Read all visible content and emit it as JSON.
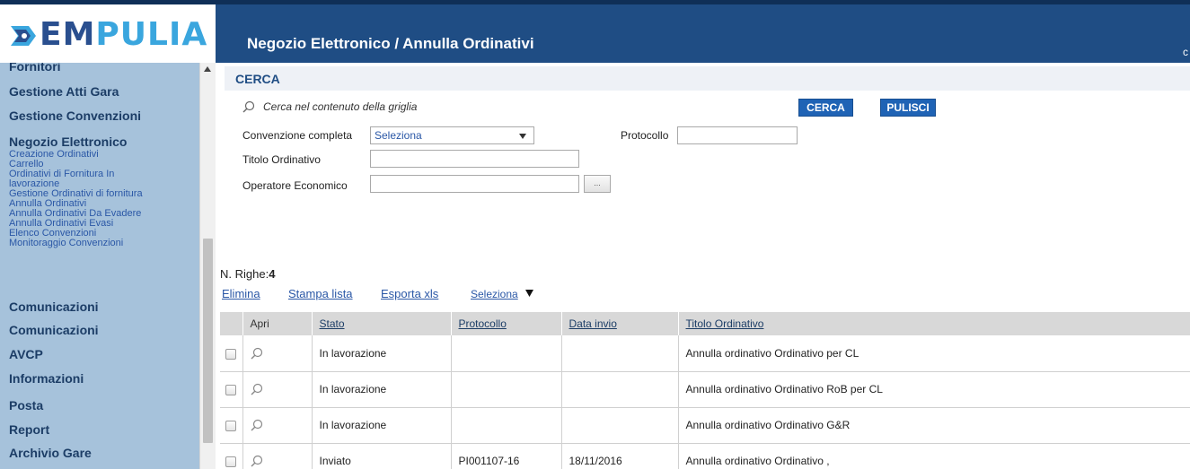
{
  "app": {
    "logo_part1": "EM",
    "logo_part2": "PULIA",
    "title": "Negozio Elettronico / Annulla Ordinativi"
  },
  "sidebar": {
    "categories": [
      {
        "label": "Fornitori"
      },
      {
        "label": "Gestione Atti Gara"
      },
      {
        "label": "Gestione Convenzioni"
      },
      {
        "label": "Negozio Elettronico"
      },
      {
        "label": "Comunicazioni"
      },
      {
        "label": "Comunicazioni"
      },
      {
        "label": "AVCP"
      },
      {
        "label": "Informazioni"
      },
      {
        "label": "Posta"
      },
      {
        "label": "Report"
      },
      {
        "label": "Archivio Gare"
      }
    ],
    "subitems": [
      {
        "label": "Creazione Ordinativi"
      },
      {
        "label": "Carrello"
      },
      {
        "label": "Ordinativi di Fornitura In"
      },
      {
        "label": "lavorazione"
      },
      {
        "label": "Gestione Ordinativi di fornitura"
      },
      {
        "label": "Annulla Ordinativi"
      },
      {
        "label": "Annulla Ordinativi Da Evadere"
      },
      {
        "label": "Annulla Ordinativi Evasi"
      },
      {
        "label": "Elenco Convenzioni"
      },
      {
        "label": "Monitoraggio Convenzioni"
      }
    ]
  },
  "search": {
    "header": "CERCA",
    "grid_search_label": "Cerca nel contenuto della griglia",
    "cerca_button": "CERCA",
    "pulisci_button": "PULISCI",
    "convenzione_label": "Convenzione completa",
    "convenzione_value": "Seleziona",
    "protocollo_label": "Protocollo",
    "protocollo_value": "",
    "titolo_label": "Titolo Ordinativo",
    "titolo_value": "",
    "operatore_label": "Operatore Economico",
    "operatore_value": "",
    "operatore_button": "..."
  },
  "list": {
    "count_label": "N. Righe:",
    "count_value": "4",
    "actions": {
      "elimina": "Elimina",
      "stampa": "Stampa lista",
      "esporta": "Esporta xls",
      "seleziona": "Seleziona"
    },
    "columns": [
      "Apri",
      "Stato",
      "Protocollo",
      "Data invio",
      "Titolo Ordinativo"
    ],
    "rows": [
      {
        "stato": "In lavorazione",
        "protocollo": "",
        "data_invio": "",
        "titolo": "Annulla ordinativo Ordinativo per CL"
      },
      {
        "stato": "In lavorazione",
        "protocollo": "",
        "data_invio": "",
        "titolo": "Annulla ordinativo Ordinativo RoB per CL"
      },
      {
        "stato": "In lavorazione",
        "protocollo": "",
        "data_invio": "",
        "titolo": "Annulla ordinativo Ordinativo G&R"
      },
      {
        "stato": "Inviato",
        "protocollo": "PI001107-16",
        "data_invio": "18/11/2016",
        "titolo": "Annulla ordinativo Ordinativo ,"
      }
    ]
  },
  "colors": {
    "header_bg": "#1f4d84",
    "sidebar_bg": "#a6c2db",
    "button_bg": "#1f63b5",
    "link": "#2a57a6"
  },
  "icons": [
    "empulia-logo-icon",
    "search-icon",
    "dropdown-caret-icon",
    "sort-down-icon",
    "magnifier-icon",
    "scroll-up-icon"
  ]
}
